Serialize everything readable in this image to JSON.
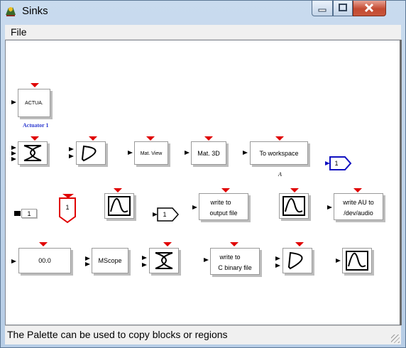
{
  "window": {
    "title": "Sinks"
  },
  "menu": {
    "file": "File"
  },
  "status": {
    "text": "The Palette can be used to copy blocks or regions"
  },
  "blocks": {
    "actuator": "ACTUA.",
    "actuator_sub": "Actuator 1",
    "matview": "Mat. View",
    "mat3d": "Mat. 3D",
    "toworkspace": "To workspace",
    "toworkspace_sub": "A",
    "outport_blue": "1",
    "const_out": "1",
    "red_out": "1",
    "outport_small": "1",
    "writefile_1": "write to",
    "writefile_2": "output file",
    "writeau_1": "write AU to",
    "writeau_2": "/dev/audio",
    "display": "00.0",
    "mscope": "MScope",
    "writec_1": "write to",
    "writec_2": "C binary file"
  },
  "colors": {
    "port": "#e00000",
    "accent": "#1010c0",
    "titlebar": "#c9dbee"
  }
}
